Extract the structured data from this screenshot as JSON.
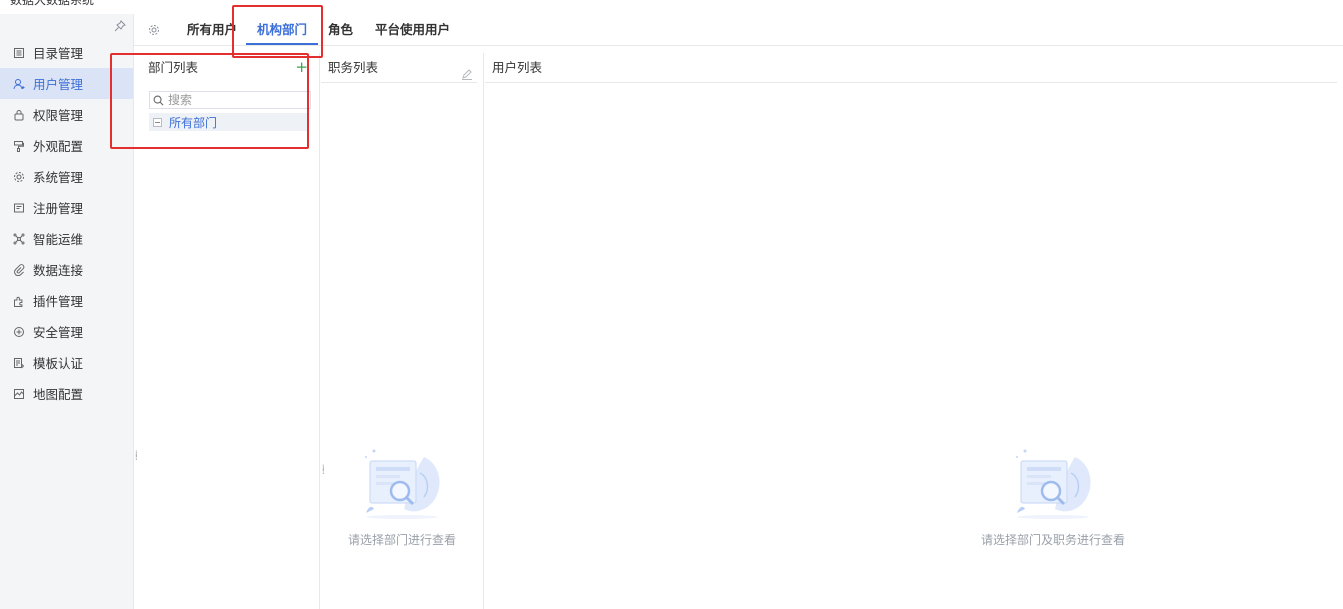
{
  "app": {
    "title": "数据大数据系统"
  },
  "sidebar": {
    "items": [
      {
        "label": "目录管理",
        "icon": "catalog-icon"
      },
      {
        "label": "用户管理",
        "icon": "user-icon",
        "active": true
      },
      {
        "label": "权限管理",
        "icon": "lock-icon"
      },
      {
        "label": "外观配置",
        "icon": "brush-icon"
      },
      {
        "label": "系统管理",
        "icon": "gear-icon"
      },
      {
        "label": "注册管理",
        "icon": "register-icon"
      },
      {
        "label": "智能运维",
        "icon": "nodes-icon"
      },
      {
        "label": "数据连接",
        "icon": "link-icon"
      },
      {
        "label": "插件管理",
        "icon": "puzzle-icon"
      },
      {
        "label": "安全管理",
        "icon": "shield-icon"
      },
      {
        "label": "模板认证",
        "icon": "template-icon"
      },
      {
        "label": "地图配置",
        "icon": "map-icon"
      }
    ]
  },
  "tabs": [
    {
      "label": "所有用户"
    },
    {
      "label": "机构部门",
      "active": true
    },
    {
      "label": "角色"
    },
    {
      "label": "平台使用用户"
    }
  ],
  "dept_panel": {
    "title": "部门列表",
    "add_label": "+",
    "search_placeholder": "搜索",
    "tree": [
      {
        "label": "所有部门"
      }
    ]
  },
  "duty_panel": {
    "title": "职务列表",
    "empty_text": "请选择部门进行查看"
  },
  "user_panel": {
    "title": "用户列表",
    "empty_text": "请选择部门及职务进行查看"
  },
  "colors": {
    "accent": "#3c6fd8",
    "highlight_box": "#e32f2f",
    "add": "#3aa34d"
  }
}
